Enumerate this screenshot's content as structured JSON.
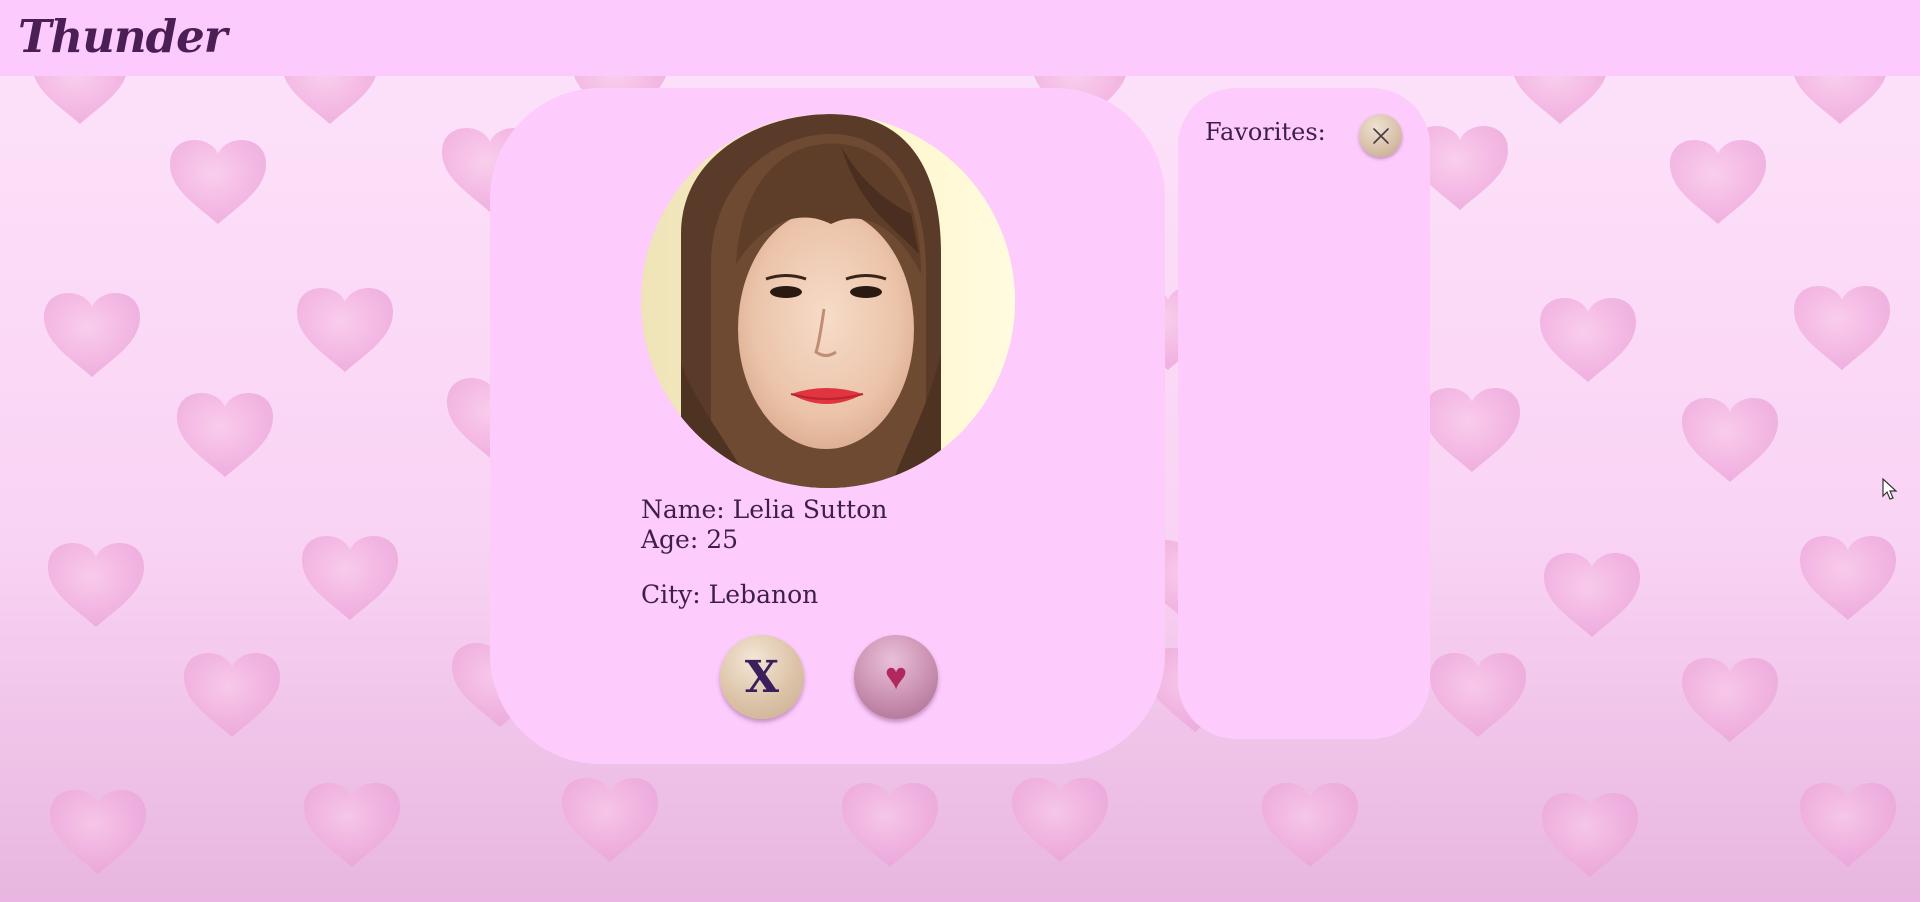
{
  "app": {
    "title": "Thunder"
  },
  "profile": {
    "name_text": "Name: Lelia Sutton",
    "age_text": "Age: 25",
    "city_text": "City: Lebanon",
    "photo_alt": "Profile photo"
  },
  "actions": {
    "reject_label": "X",
    "like_label": "♥"
  },
  "favorites": {
    "title": "Favorites:",
    "items": []
  },
  "icons": {
    "clear_favorites": "close-icon",
    "background": "heart-icon",
    "cursor": "mouse-pointer-icon"
  },
  "colors": {
    "topbar": "#fdcafd",
    "panel": "#fdcbfc",
    "text": "#3e1f4a",
    "brand": "#4a1f55",
    "heart": "#b0285e"
  }
}
